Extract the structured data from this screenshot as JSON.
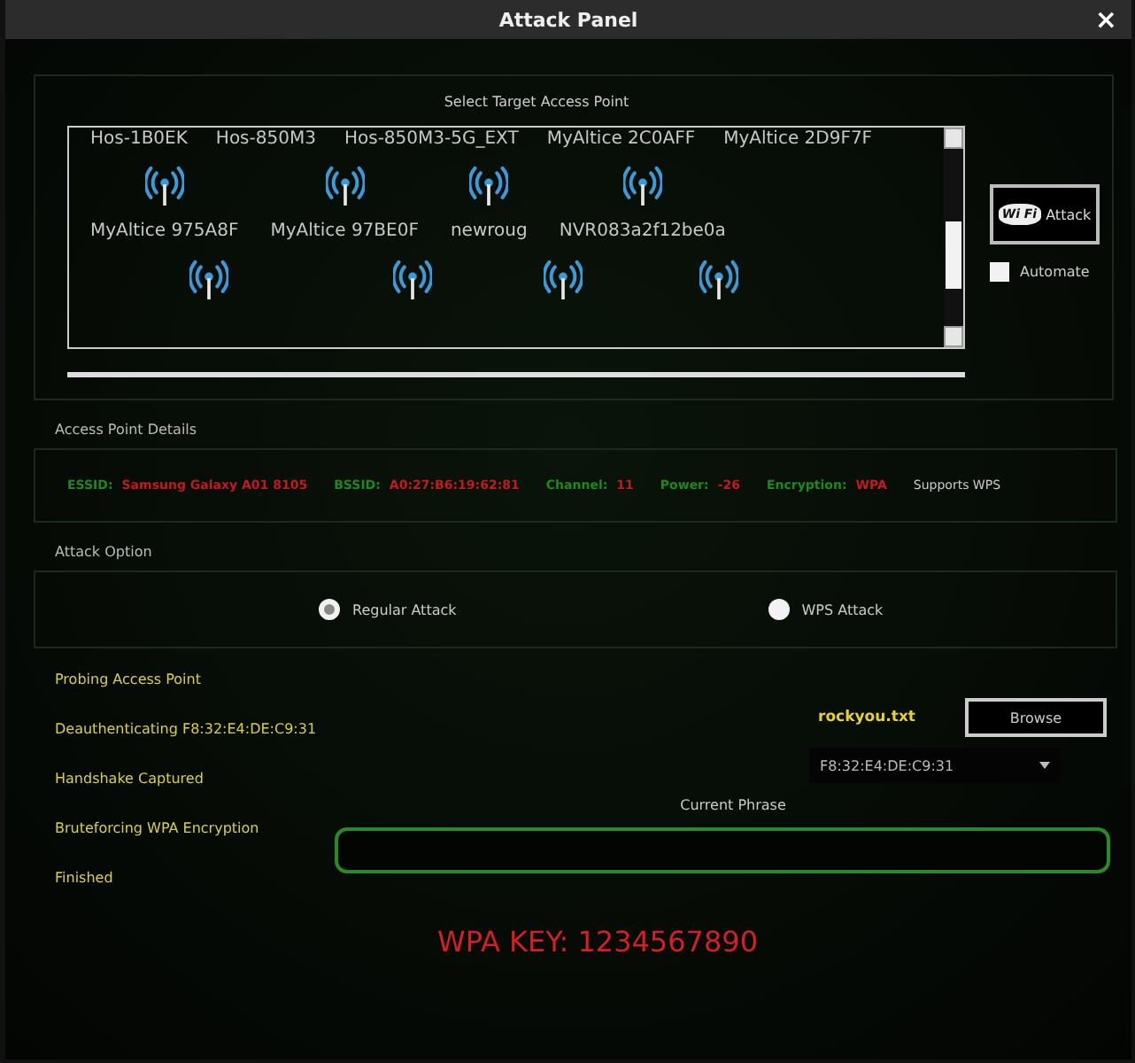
{
  "window": {
    "title": "Attack Panel",
    "close": "×"
  },
  "target": {
    "label": "Select Target Access Point",
    "rows": [
      {
        "kind": "label_only",
        "items": [
          {
            "name": "Hos-1B0EK"
          },
          {
            "name": "Hos-850M3"
          },
          {
            "name": "Hos-850M3-5G_EXT"
          },
          {
            "name": "MyAltice 2C0AFF"
          },
          {
            "name": "MyAltice 2D9F7F"
          }
        ]
      },
      {
        "kind": "full",
        "items": [
          {
            "name": "MyAltice 975A8F"
          },
          {
            "name": "MyAltice 97BE0F"
          },
          {
            "name": "newroug"
          },
          {
            "name": "NVR083a2f12be0a"
          }
        ]
      },
      {
        "kind": "icon_only",
        "items": [
          {
            "kind": "antenna"
          },
          {
            "kind": "antenna"
          },
          {
            "kind": "antenna"
          },
          {
            "kind": "antenna"
          }
        ]
      }
    ]
  },
  "attack_button": {
    "icon_text": "Wi Fi",
    "label": "Attack"
  },
  "automate": {
    "label": "Automate",
    "checked": false
  },
  "details": {
    "label": "Access Point Details",
    "fields": [
      {
        "key": "ESSID:",
        "value": "Samsung Galaxy A01 8105"
      },
      {
        "key": "BSSID:",
        "value": "A0:27:B6:19:62:81"
      },
      {
        "key": "Channel:",
        "value": "11"
      },
      {
        "key": "Power:",
        "value": "-26"
      },
      {
        "key": "Encryption:",
        "value": "WPA"
      }
    ],
    "note": "Supports WPS"
  },
  "attack_option": {
    "label": "Attack Option",
    "options": [
      {
        "label": "Regular Attack",
        "selected": true
      },
      {
        "label": "WPS  Attack",
        "selected": false
      }
    ]
  },
  "steps": [
    "Probing Access Point",
    "Deauthenticating F8:32:E4:DE:C9:31",
    "Handshake Captured",
    "Bruteforcing WPA Encryption",
    "Finished"
  ],
  "wordlist": {
    "file": "rockyou.txt",
    "button": "Browse"
  },
  "client_select": {
    "value": "F8:32:E4:DE:C9:31"
  },
  "phrase": {
    "label": "Current Phrase"
  },
  "result": "WPA KEY: 1234567890"
}
